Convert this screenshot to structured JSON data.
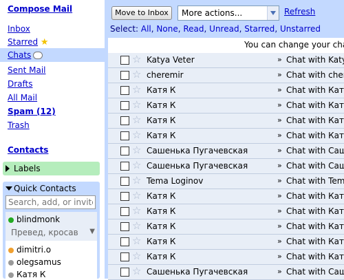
{
  "sidebar": {
    "compose": "Compose Mail",
    "inbox": "Inbox",
    "starred": "Starred",
    "chats": "Chats",
    "sent": "Sent Mail",
    "drafts": "Drafts",
    "all": "All Mail",
    "spam": "Spam (12)",
    "trash": "Trash",
    "contacts": "Contacts",
    "labels": "Labels",
    "quick_contacts": "Quick Contacts",
    "search_placeholder": "Search, add, or invite",
    "me_name": "blindmonk",
    "me_status": "Превед, кросав",
    "contacts_list": [
      {
        "name": "dimitri.o",
        "status": "away"
      },
      {
        "name": "olegsamus",
        "status": "offline"
      },
      {
        "name": "Катя К",
        "status": "offline"
      }
    ]
  },
  "toolbar": {
    "move_to_inbox": "Move to Inbox",
    "more_actions": "More actions...",
    "refresh": "Refresh"
  },
  "select": {
    "prefix": "Select:",
    "options": [
      "All",
      "None",
      "Read",
      "Unread",
      "Starred",
      "Unstarred"
    ]
  },
  "notice": "You can change your cha",
  "rows": [
    {
      "sender": "Katya Veter",
      "subject": "Chat with Katya"
    },
    {
      "sender": "cheremir",
      "subject": "Chat with cherem"
    },
    {
      "sender": "Катя К",
      "subject": "Chat with Катя"
    },
    {
      "sender": "Катя К",
      "subject": "Chat with Катя"
    },
    {
      "sender": "Катя К",
      "subject": "Chat with Катя"
    },
    {
      "sender": "Катя К",
      "subject": "Chat with Катя"
    },
    {
      "sender": "Сашенька Пугачевская",
      "subject": "Chat with Саш"
    },
    {
      "sender": "Сашенька Пугачевская",
      "subject": "Chat with Саш"
    },
    {
      "sender": "Tema Loginov",
      "subject": "Chat with Tema"
    },
    {
      "sender": "Катя К",
      "subject": "Chat with Катя"
    },
    {
      "sender": "Катя К",
      "subject": "Chat with Катя"
    },
    {
      "sender": "Катя К",
      "subject": "Chat with Катя"
    },
    {
      "sender": "Катя К",
      "subject": "Chat with Катя"
    },
    {
      "sender": "Катя К",
      "subject": "Chat with Катя"
    },
    {
      "sender": "Сашенька Пугачевская",
      "subject": "Chat with Саш"
    }
  ],
  "colors": {
    "link": "#0000cc",
    "panel": "#c3d9ff",
    "row": "#e8eef7",
    "labels_bg": "#b5edbc",
    "online": "#22aa22",
    "away": "#f0a030",
    "offline": "#999999"
  },
  "icons": {
    "starred": "star-icon",
    "chats": "chat-bubble-icon",
    "row_star": "star-outline-icon"
  }
}
